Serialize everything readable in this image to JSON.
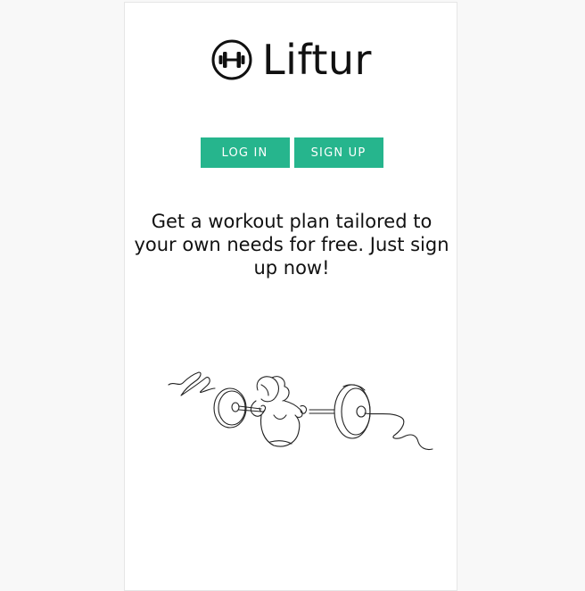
{
  "brand": {
    "name": "Liftur",
    "icon": "dumbbell-icon"
  },
  "auth": {
    "login_label": "LOG IN",
    "signup_label": "SIGN UP"
  },
  "hero": {
    "tagline": "Get a workout plan tailored to your own needs for free. Just sign up now!",
    "illustration": "barbell-squat-line-drawing"
  },
  "colors": {
    "accent": "#26b58d",
    "text": "#111111",
    "background": "#f8f8f8",
    "card": "#ffffff"
  }
}
